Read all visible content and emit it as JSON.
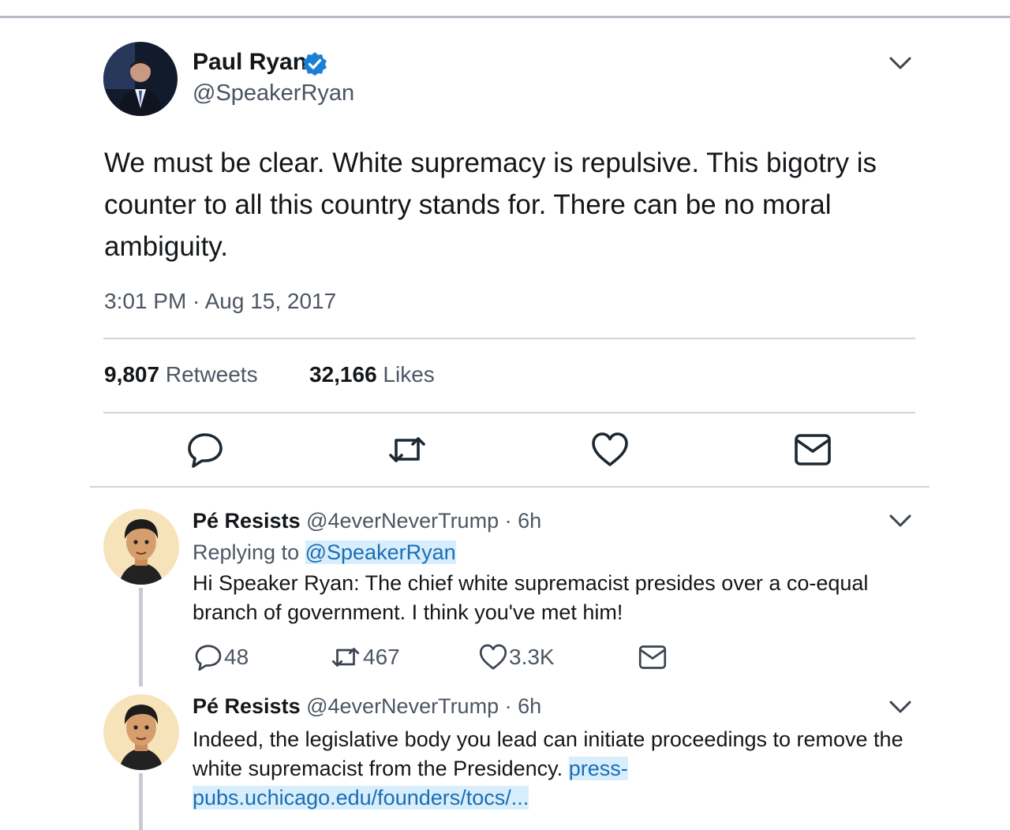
{
  "main_tweet": {
    "author_name": "Paul Ryan",
    "handle": "@SpeakerRyan",
    "text": "We must be clear. White supremacy is repulsive. This bigotry is counter to all this country stands for. There can be no moral ambiguity.",
    "timestamp": "3:01 PM · Aug 15, 2017",
    "retweets_count": "9,807",
    "retweets_label": "Retweets",
    "likes_count": "32,166",
    "likes_label": "Likes",
    "icons": [
      "reply-icon",
      "retweet-icon",
      "like-icon",
      "dm-icon",
      "chevron-down-icon",
      "verified-icon"
    ]
  },
  "replies": [
    {
      "author_name": "Pé Resists",
      "meta": "@4everNeverTrump · 6h",
      "replying_to_label": "Replying to",
      "replying_to_handle": "@SpeakerRyan",
      "text": "Hi Speaker Ryan: The chief white supremacist presides over a co-equal branch of government. I think you've met him!",
      "reply_count": "48",
      "retweet_count": "467",
      "like_count": "3.3K"
    },
    {
      "author_name": "Pé Resists",
      "meta": "@4everNeverTrump · 6h",
      "text": "Indeed, the legislative body you lead can initiate proceedings to remove the white supremacist from the Presidency.",
      "link_text": "press-pubs.uchicago.edu/founders/tocs/..."
    }
  ],
  "colors": {
    "accent": "#1da1f2",
    "text": "#14171a",
    "muted": "#4d5663",
    "divider": "#cfd4db",
    "link_highlight": "#d8eefc"
  }
}
